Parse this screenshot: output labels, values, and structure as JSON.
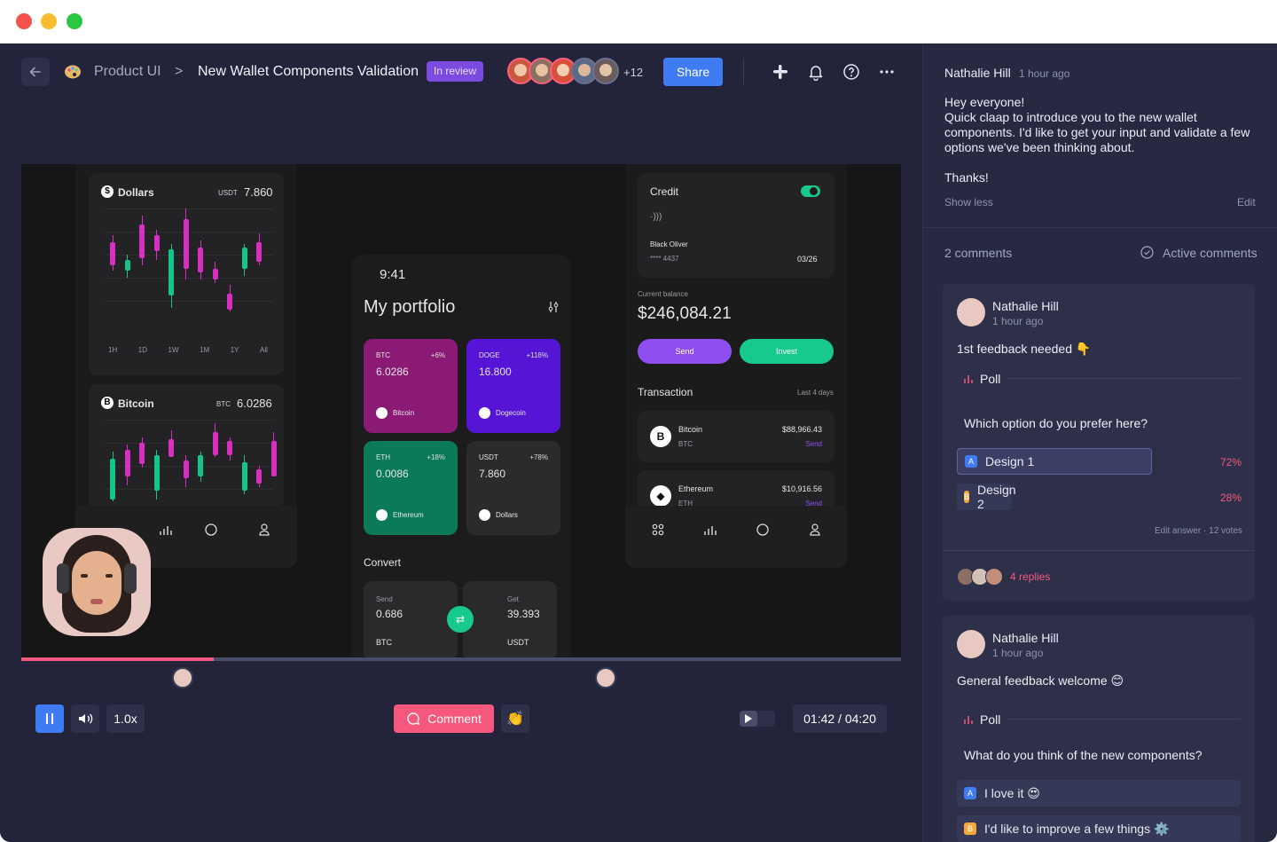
{
  "window": {
    "dot_colors": [
      "#f3524e",
      "#f6bd2f",
      "#2ac840"
    ]
  },
  "header": {
    "project": "Product UI",
    "separator": ">",
    "title": "New Wallet Components Validation",
    "status_badge": "In review",
    "extra_participants": "+12",
    "share_label": "Share",
    "icons": [
      "back-arrow-icon",
      "palette-icon",
      "slack-icon",
      "bell-icon",
      "help-icon",
      "more-icon"
    ]
  },
  "mockup": {
    "dollars_card": {
      "title": "Dollars",
      "unit": "USDT",
      "value": "7.860",
      "ranges": [
        "1H",
        "1D",
        "1W",
        "1M",
        "1Y",
        "All"
      ]
    },
    "bitcoin_card": {
      "title": "Bitcoin",
      "unit": "BTC",
      "value": "6.0286"
    },
    "phone": {
      "time": "9:41",
      "title": "My portfolio",
      "tiles": [
        {
          "code": "BTC",
          "change": "+6%",
          "amount": "6.0286",
          "name": "Bitcoin",
          "color": "#8a1a74"
        },
        {
          "code": "DOGE",
          "change": "+118%",
          "amount": "16.800",
          "name": "Dogecoin",
          "color": "#5514d6"
        },
        {
          "code": "ETH",
          "change": "+18%",
          "amount": "0.0086",
          "name": "Ethereum",
          "color": "#0b7a58"
        },
        {
          "code": "USDT",
          "change": "+78%",
          "amount": "7.860",
          "name": "Dollars",
          "color": "#2b2b2d"
        }
      ],
      "convert_title": "Convert",
      "send_label": "Send",
      "send_value": "0.686",
      "send_currency": "BTC",
      "get_label": "Get",
      "get_value": "39.393",
      "get_currency": "USDT"
    },
    "credit": {
      "title": "Credit",
      "holder": "Black Oliver",
      "number": "**** 4437",
      "expiry": "03/26",
      "balance_label": "Current balance",
      "balance": "$246,084.21",
      "send_label": "Send",
      "invest_label": "Invest",
      "transaction_title": "Transaction",
      "transaction_period": "Last 4 days",
      "transactions": [
        {
          "name": "Bitcoin",
          "code": "BTC",
          "amount": "$88,966.43",
          "action": "Send"
        },
        {
          "name": "Ethereum",
          "code": "ETH",
          "amount": "$10,916.56",
          "action": "Send"
        }
      ]
    }
  },
  "player": {
    "progress": 0.219,
    "speed": "1.0x",
    "comment_label": "Comment",
    "time": "01:42 / 04:20",
    "accent": "#f5587c"
  },
  "panel": {
    "post": {
      "author": "Nathalie Hill",
      "time": "1 hour ago",
      "line1": "Hey everyone!",
      "line2": "Quick claap to introduce you to the new wallet components. I'd like to get your input and validate a few options we've been thinking about.",
      "line3": "Thanks!",
      "show_less": "Show less",
      "edit": "Edit"
    },
    "comments_count": "2 comments",
    "active_comments": "Active comments",
    "comments": [
      {
        "author": "Nathalie Hill",
        "time": "1 hour ago",
        "text": "1st feedback needed 👇",
        "poll_label": "Poll",
        "question": "Which option do you prefer here?",
        "options": [
          {
            "letter": "A",
            "label": "Design 1",
            "percent": "72%"
          },
          {
            "letter": "B",
            "label": "Design 2",
            "percent": "28%"
          }
        ],
        "meta": "Edit answer · 12 votes",
        "replies": "4 replies"
      },
      {
        "author": "Nathalie Hill",
        "time": "1 hour ago",
        "text": "General feedback welcome 😊",
        "poll_label": "Poll",
        "question": "What do you think of the new components?",
        "options": [
          {
            "letter": "A",
            "label": "I love it 😍"
          },
          {
            "letter": "B",
            "label": "I'd like to improve a few things ⚙️"
          }
        ]
      }
    ]
  }
}
